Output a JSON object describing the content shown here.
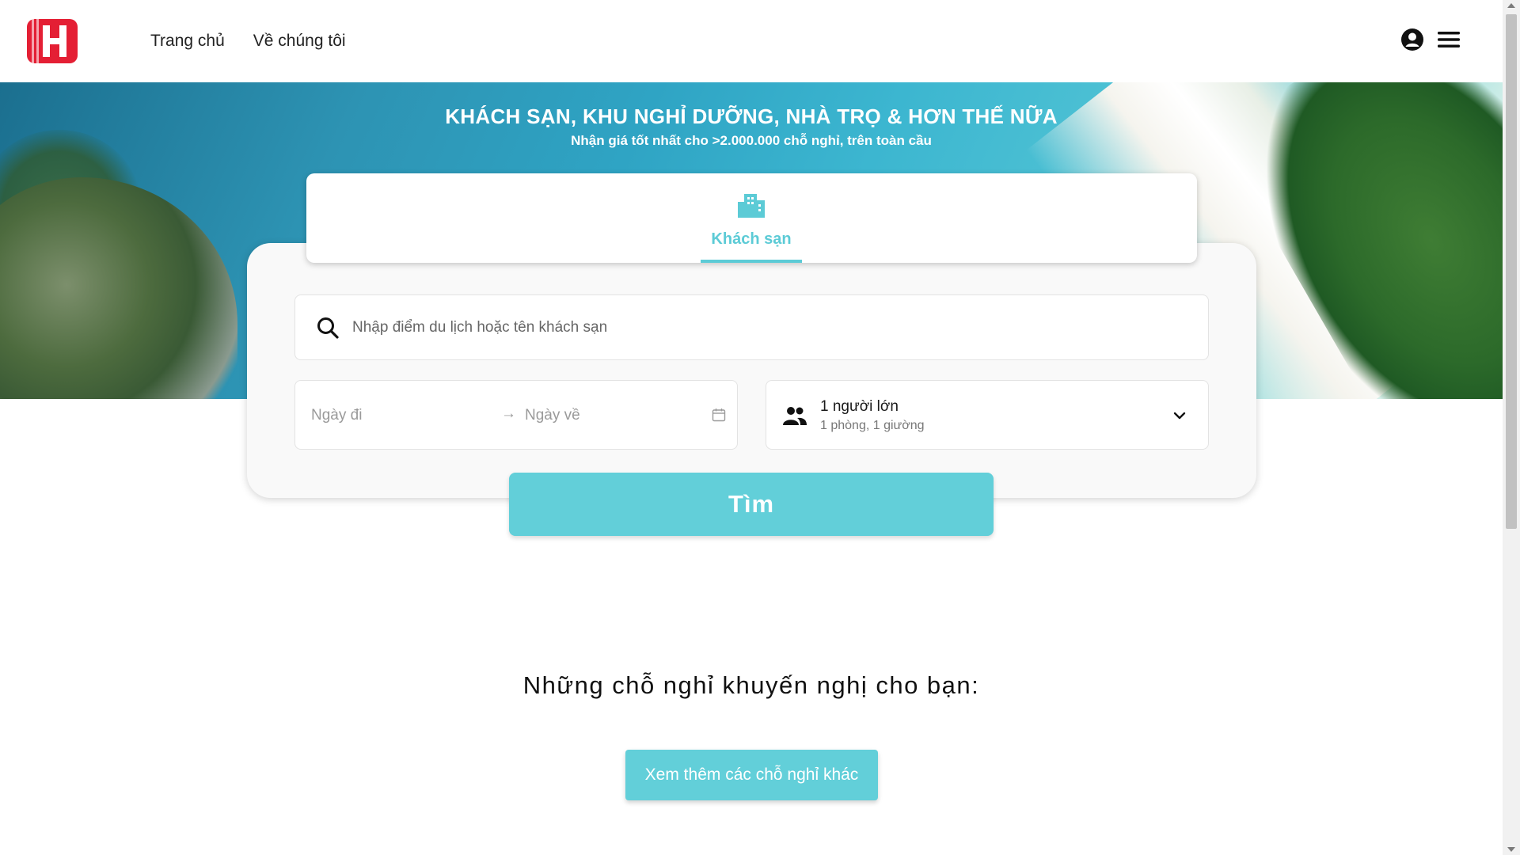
{
  "header": {
    "logo_icon": "hotels-h-logo",
    "brand_color": "#e41f34",
    "nav": [
      {
        "label": "Trang chủ"
      },
      {
        "label": "Về chúng tôi"
      }
    ],
    "account_icon": "user-circle-icon",
    "menu_icon": "hamburger-menu-icon"
  },
  "hero": {
    "title": "KHÁCH SẠN, KHU NGHỈ DƯỠNG, NHÀ TRỌ & HƠN THẾ NỮA",
    "subtitle": "Nhận giá tốt nhất cho >2.000.000 chỗ nghỉ, trên toàn cầu"
  },
  "search": {
    "tabs": [
      {
        "label": "Khách sạn",
        "icon": "hotel-building-icon",
        "active": true
      }
    ],
    "query_placeholder": "Nhập điểm du lịch hoặc tên khách sạn",
    "date_from_placeholder": "Ngày đi",
    "date_arrow": "→",
    "date_to_placeholder": "Ngày về",
    "guests_main": "1 người lớn",
    "guests_sub": "1 phòng, 1 giường",
    "submit_label": "Tìm"
  },
  "recommendations": {
    "title": "Những chỗ nghỉ khuyến nghị cho bạn:",
    "more_label": "Xem thêm các chỗ nghỉ khác"
  },
  "colors": {
    "accent": "#62cfd9",
    "tab_active": "#5ccbd6"
  }
}
